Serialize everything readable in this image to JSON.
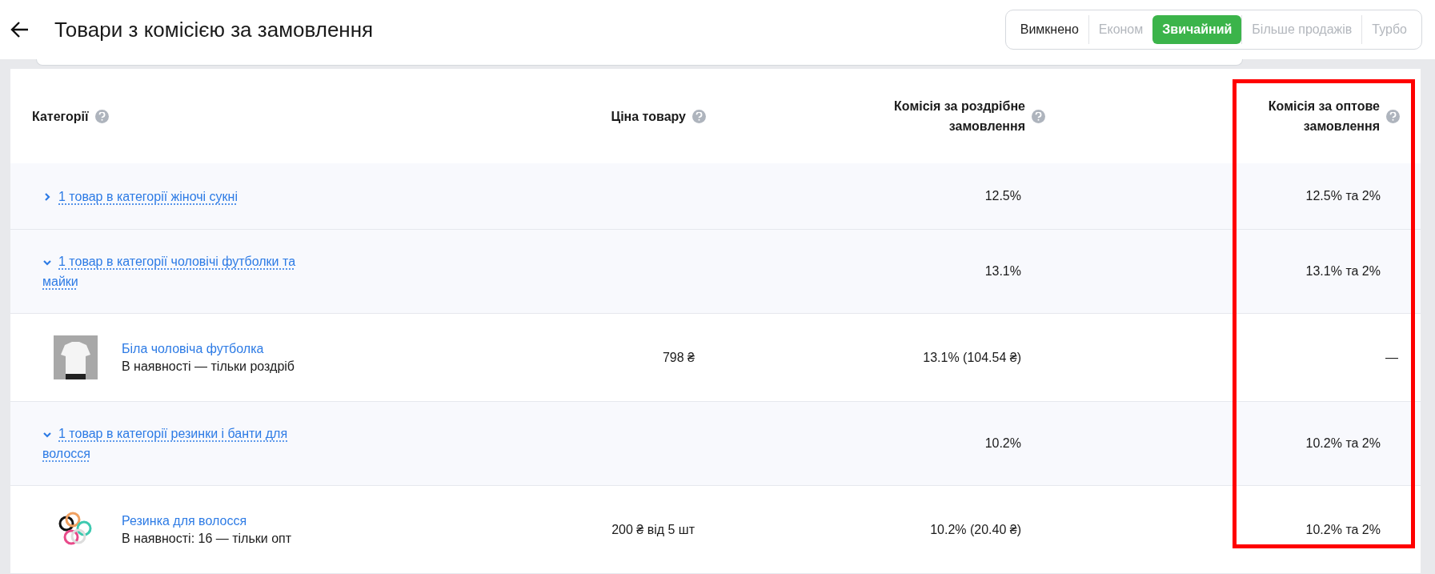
{
  "header": {
    "title": "Товари з комісією за замовлення",
    "modes": [
      {
        "label": "Вимкнено",
        "selected": false,
        "disabled": false
      },
      {
        "label": "Економ",
        "selected": false,
        "disabled": true
      },
      {
        "label": "Звичайний",
        "selected": true,
        "disabled": false
      },
      {
        "label": "Більше продажів",
        "selected": false,
        "disabled": true
      },
      {
        "label": "Турбо",
        "selected": false,
        "disabled": true
      }
    ]
  },
  "table": {
    "columns": [
      {
        "label": "Категорії"
      },
      {
        "label": "Ціна товару"
      },
      {
        "label": "Комісія за роздрібне замовлення"
      },
      {
        "label": "Комісія за оптове замовлення"
      }
    ],
    "rows": [
      {
        "kind": "category",
        "expanded": false,
        "label": "1 товар в категорії жіночі сукні",
        "retail": "12.5%",
        "wholesale": "12.5% та 2%"
      },
      {
        "kind": "category",
        "expanded": true,
        "label": "1 товар в категорії чоловічі футболки та майки",
        "retail": "13.1%",
        "wholesale": "13.1% та 2%"
      },
      {
        "kind": "product",
        "name": "Біла чоловіча футболка",
        "stock": "В наявності — тільки роздріб",
        "price": "798 ₴",
        "retail": "13.1% (104.54 ₴)",
        "wholesale": "—"
      },
      {
        "kind": "category",
        "expanded": true,
        "label": "1 товар в категорії резинки і банти для волосся",
        "retail": "10.2%",
        "wholesale": "10.2% та 2%"
      },
      {
        "kind": "product",
        "name": "Резинка для волосся",
        "stock": "В наявності: 16 — тільки опт",
        "price": "200 ₴ від 5 шт",
        "retail": "10.2% (20.40 ₴)",
        "wholesale": "10.2% та 2%"
      }
    ]
  }
}
